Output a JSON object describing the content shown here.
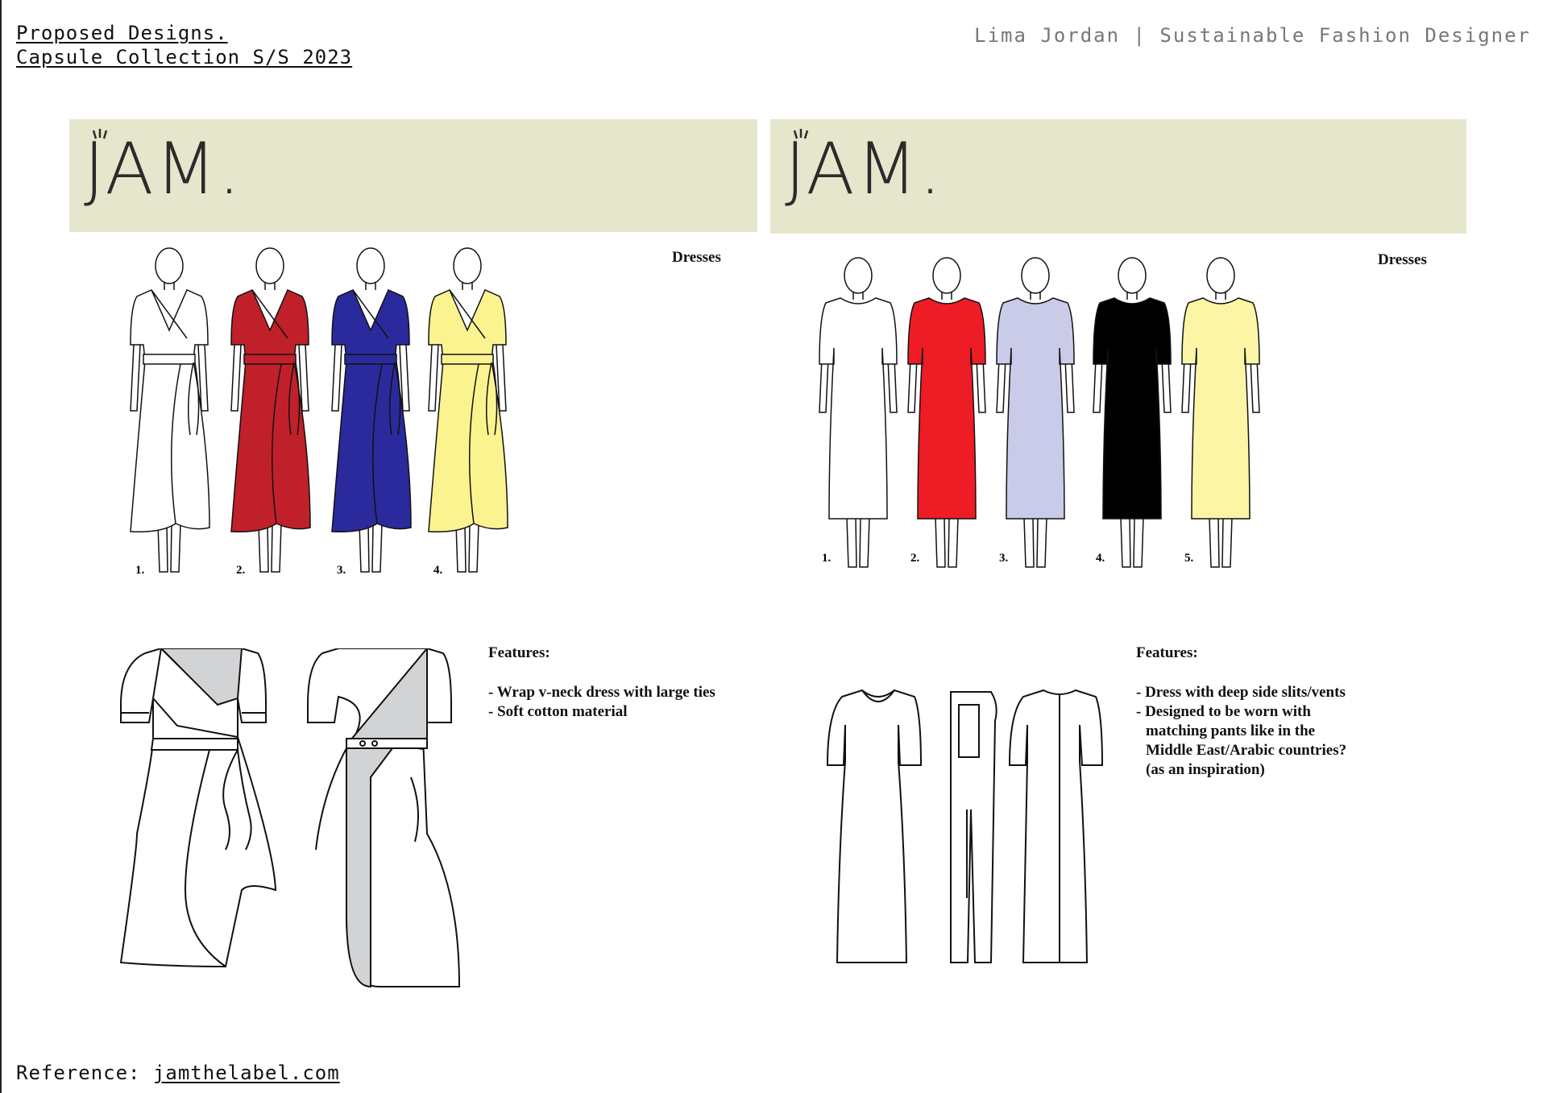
{
  "header": {
    "title_line1": "Proposed Designs.",
    "title_line2": "Capsule Collection S/S 2023",
    "author": "Lima Jordan | Sustainable Fashion Designer"
  },
  "panels": [
    {
      "logo": "JAM.",
      "category": "Dresses",
      "colorways": [
        {
          "number": "1.",
          "color": "#ffffff"
        },
        {
          "number": "2.",
          "color": "#c0202a"
        },
        {
          "number": "3.",
          "color": "#2a2a9c"
        },
        {
          "number": "4.",
          "color": "#fbf390"
        }
      ],
      "features_title": "Features:",
      "features": [
        "- Wrap v-neck dress with large ties",
        "- Soft cotton material"
      ]
    },
    {
      "logo": "JAM.",
      "category": "Dresses",
      "colorways": [
        {
          "number": "1.",
          "color": "#ffffff"
        },
        {
          "number": "2.",
          "color": "#ee1c25"
        },
        {
          "number": "3.",
          "color": "#c9cbe8"
        },
        {
          "number": "4.",
          "color": "#000000"
        },
        {
          "number": "5.",
          "color": "#fdf5a6"
        }
      ],
      "features_title": "Features:",
      "features": [
        "- Dress with deep side slits/vents",
        "- Designed to be worn with",
        "matching pants like in the",
        "Middle East/Arabic countries?",
        "(as an inspiration)"
      ]
    }
  ],
  "footer": {
    "reference_label": "Reference: ",
    "reference_link": "jamthelabel.com"
  },
  "colors": {
    "banner": "#e6e6cc",
    "lining_gray": "#d2d3d5"
  }
}
